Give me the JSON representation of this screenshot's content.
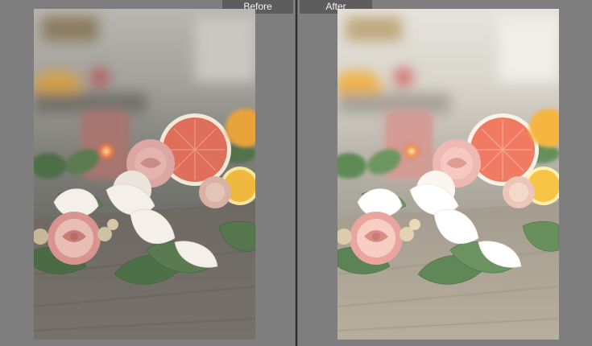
{
  "compare": {
    "before_label": "Before",
    "after_label": "After"
  },
  "colors": {
    "workspace_bg": "#7e7e7e",
    "label_bg": "#5d5d5d",
    "label_text": "#f2f2f2"
  },
  "photo": {
    "subject": "flowers-and-citrus-on-wood-table"
  }
}
